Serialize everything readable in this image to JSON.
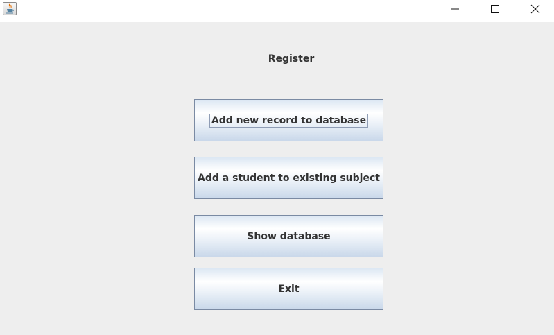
{
  "titlebar": {
    "app_icon": "java-cup-icon",
    "controls": {
      "minimize": "minimize-icon",
      "maximize": "maximize-icon",
      "close": "close-icon"
    }
  },
  "main": {
    "heading": "Register",
    "buttons": [
      {
        "label": "Add new record to database",
        "focused": true
      },
      {
        "label": "Add a student to existing subject",
        "focused": false
      },
      {
        "label": "Show database",
        "focused": false
      },
      {
        "label": "Exit",
        "focused": false
      }
    ]
  },
  "colors": {
    "background": "#eeeeee",
    "button_border": "#7a8aa3",
    "text": "#333333"
  }
}
